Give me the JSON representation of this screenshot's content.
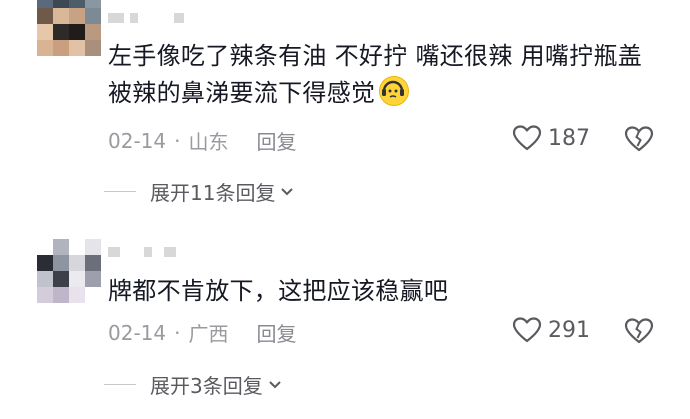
{
  "comments": [
    {
      "text": "左手像吃了辣条有油 不好拧 嘴还很辣 用嘴拧瓶盖 被辣的鼻涕要流下得感觉",
      "emoji_icon": "headphones-sweat-emoji",
      "date": "02-14",
      "separator": "·",
      "location": "山东",
      "reply_label": "回复",
      "likes": "187",
      "expand_label": "展开11条回复"
    },
    {
      "text": "牌都不肯放下，这把应该稳赢吧",
      "date": "02-14",
      "separator": "·",
      "location": "广西",
      "reply_label": "回复",
      "likes": "291",
      "expand_label": "展开3条回复"
    }
  ],
  "colors": {
    "text": "#161823",
    "meta": "#9a9aa0",
    "icon": "#5a5a60"
  }
}
